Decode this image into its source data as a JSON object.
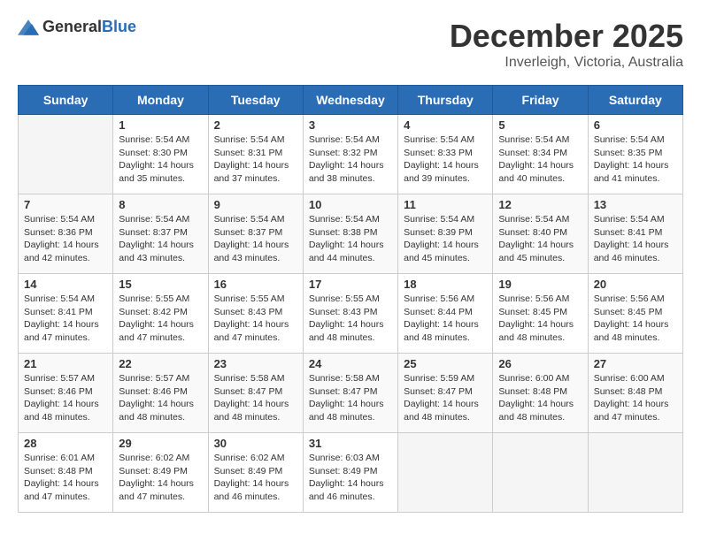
{
  "header": {
    "logo_general": "General",
    "logo_blue": "Blue",
    "month_title": "December 2025",
    "location": "Inverleigh, Victoria, Australia"
  },
  "weekdays": [
    "Sunday",
    "Monday",
    "Tuesday",
    "Wednesday",
    "Thursday",
    "Friday",
    "Saturday"
  ],
  "weeks": [
    [
      {
        "day": "",
        "info": ""
      },
      {
        "day": "1",
        "info": "Sunrise: 5:54 AM\nSunset: 8:30 PM\nDaylight: 14 hours\nand 35 minutes."
      },
      {
        "day": "2",
        "info": "Sunrise: 5:54 AM\nSunset: 8:31 PM\nDaylight: 14 hours\nand 37 minutes."
      },
      {
        "day": "3",
        "info": "Sunrise: 5:54 AM\nSunset: 8:32 PM\nDaylight: 14 hours\nand 38 minutes."
      },
      {
        "day": "4",
        "info": "Sunrise: 5:54 AM\nSunset: 8:33 PM\nDaylight: 14 hours\nand 39 minutes."
      },
      {
        "day": "5",
        "info": "Sunrise: 5:54 AM\nSunset: 8:34 PM\nDaylight: 14 hours\nand 40 minutes."
      },
      {
        "day": "6",
        "info": "Sunrise: 5:54 AM\nSunset: 8:35 PM\nDaylight: 14 hours\nand 41 minutes."
      }
    ],
    [
      {
        "day": "7",
        "info": "Sunrise: 5:54 AM\nSunset: 8:36 PM\nDaylight: 14 hours\nand 42 minutes."
      },
      {
        "day": "8",
        "info": "Sunrise: 5:54 AM\nSunset: 8:37 PM\nDaylight: 14 hours\nand 43 minutes."
      },
      {
        "day": "9",
        "info": "Sunrise: 5:54 AM\nSunset: 8:37 PM\nDaylight: 14 hours\nand 43 minutes."
      },
      {
        "day": "10",
        "info": "Sunrise: 5:54 AM\nSunset: 8:38 PM\nDaylight: 14 hours\nand 44 minutes."
      },
      {
        "day": "11",
        "info": "Sunrise: 5:54 AM\nSunset: 8:39 PM\nDaylight: 14 hours\nand 45 minutes."
      },
      {
        "day": "12",
        "info": "Sunrise: 5:54 AM\nSunset: 8:40 PM\nDaylight: 14 hours\nand 45 minutes."
      },
      {
        "day": "13",
        "info": "Sunrise: 5:54 AM\nSunset: 8:41 PM\nDaylight: 14 hours\nand 46 minutes."
      }
    ],
    [
      {
        "day": "14",
        "info": "Sunrise: 5:54 AM\nSunset: 8:41 PM\nDaylight: 14 hours\nand 47 minutes."
      },
      {
        "day": "15",
        "info": "Sunrise: 5:55 AM\nSunset: 8:42 PM\nDaylight: 14 hours\nand 47 minutes."
      },
      {
        "day": "16",
        "info": "Sunrise: 5:55 AM\nSunset: 8:43 PM\nDaylight: 14 hours\nand 47 minutes."
      },
      {
        "day": "17",
        "info": "Sunrise: 5:55 AM\nSunset: 8:43 PM\nDaylight: 14 hours\nand 48 minutes."
      },
      {
        "day": "18",
        "info": "Sunrise: 5:56 AM\nSunset: 8:44 PM\nDaylight: 14 hours\nand 48 minutes."
      },
      {
        "day": "19",
        "info": "Sunrise: 5:56 AM\nSunset: 8:45 PM\nDaylight: 14 hours\nand 48 minutes."
      },
      {
        "day": "20",
        "info": "Sunrise: 5:56 AM\nSunset: 8:45 PM\nDaylight: 14 hours\nand 48 minutes."
      }
    ],
    [
      {
        "day": "21",
        "info": "Sunrise: 5:57 AM\nSunset: 8:46 PM\nDaylight: 14 hours\nand 48 minutes."
      },
      {
        "day": "22",
        "info": "Sunrise: 5:57 AM\nSunset: 8:46 PM\nDaylight: 14 hours\nand 48 minutes."
      },
      {
        "day": "23",
        "info": "Sunrise: 5:58 AM\nSunset: 8:47 PM\nDaylight: 14 hours\nand 48 minutes."
      },
      {
        "day": "24",
        "info": "Sunrise: 5:58 AM\nSunset: 8:47 PM\nDaylight: 14 hours\nand 48 minutes."
      },
      {
        "day": "25",
        "info": "Sunrise: 5:59 AM\nSunset: 8:47 PM\nDaylight: 14 hours\nand 48 minutes."
      },
      {
        "day": "26",
        "info": "Sunrise: 6:00 AM\nSunset: 8:48 PM\nDaylight: 14 hours\nand 48 minutes."
      },
      {
        "day": "27",
        "info": "Sunrise: 6:00 AM\nSunset: 8:48 PM\nDaylight: 14 hours\nand 47 minutes."
      }
    ],
    [
      {
        "day": "28",
        "info": "Sunrise: 6:01 AM\nSunset: 8:48 PM\nDaylight: 14 hours\nand 47 minutes."
      },
      {
        "day": "29",
        "info": "Sunrise: 6:02 AM\nSunset: 8:49 PM\nDaylight: 14 hours\nand 47 minutes."
      },
      {
        "day": "30",
        "info": "Sunrise: 6:02 AM\nSunset: 8:49 PM\nDaylight: 14 hours\nand 46 minutes."
      },
      {
        "day": "31",
        "info": "Sunrise: 6:03 AM\nSunset: 8:49 PM\nDaylight: 14 hours\nand 46 minutes."
      },
      {
        "day": "",
        "info": ""
      },
      {
        "day": "",
        "info": ""
      },
      {
        "day": "",
        "info": ""
      }
    ]
  ]
}
